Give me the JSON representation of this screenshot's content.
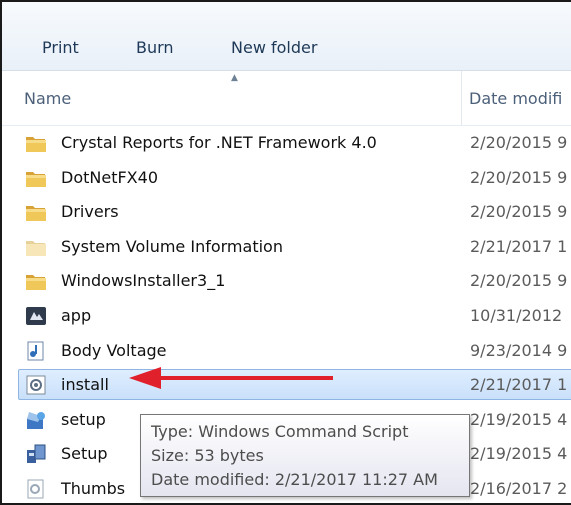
{
  "toolbar": {
    "print_label": "Print",
    "burn_label": "Burn",
    "new_folder_label": "New folder"
  },
  "columns": {
    "name": "Name",
    "date": "Date modifi"
  },
  "files": [
    {
      "name": "Crystal Reports for .NET Framework 4.0",
      "date": "2/20/2015 9",
      "icon": "folder-icon"
    },
    {
      "name": "DotNetFX40",
      "date": "2/20/2015 9",
      "icon": "folder-icon"
    },
    {
      "name": "Drivers",
      "date": "2/20/2015 9",
      "icon": "folder-icon"
    },
    {
      "name": "System Volume Information",
      "date": "2/21/2017 1",
      "icon": "system-folder-icon"
    },
    {
      "name": "WindowsInstaller3_1",
      "date": "2/20/2015 9",
      "icon": "folder-icon"
    },
    {
      "name": "app",
      "date": "10/31/2012",
      "icon": "app-icon"
    },
    {
      "name": "Body Voltage",
      "date": "9/23/2014 9",
      "icon": "audio-file-icon"
    },
    {
      "name": "install",
      "date": "2/21/2017 1",
      "icon": "script-file-icon",
      "selected": true
    },
    {
      "name": "setup",
      "date": "2/19/2015 4",
      "icon": "setup-icon"
    },
    {
      "name": "Setup",
      "date": "2/19/2015 4",
      "icon": "installer-icon"
    },
    {
      "name": "Thumbs",
      "date": "2/16/2017 2",
      "icon": "thumbs-file-icon"
    }
  ],
  "tooltip": {
    "type": "Type: Windows Command Script",
    "size": "Size: 53 bytes",
    "date": "Date modified: 2/21/2017 11:27 AM"
  },
  "colors": {
    "selection": "#cce4fb",
    "arrow": "#e0202a",
    "folder": "#e8b84a"
  }
}
